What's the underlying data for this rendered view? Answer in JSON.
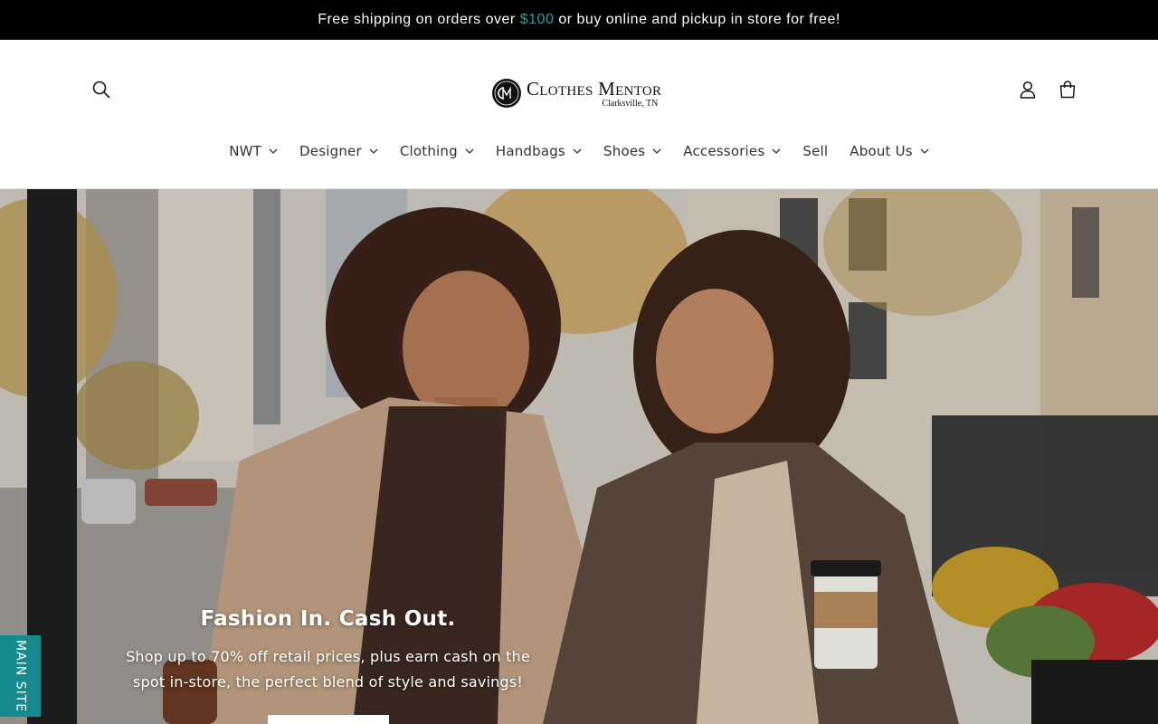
{
  "announcement": {
    "before": "Free shipping on orders over",
    "amount": "$100",
    "after": "or buy online and pickup in store for free!",
    "accent_color": "#1fa3a8"
  },
  "header": {
    "logo": {
      "name": "Clothes Mentor",
      "location": "Clarksville, TN",
      "monogram": "CM"
    },
    "icons": {
      "search": "search-icon",
      "account": "user-icon",
      "cart": "cart-icon"
    }
  },
  "nav": {
    "items": [
      {
        "label": "NWT",
        "has_dropdown": true
      },
      {
        "label": "Designer",
        "has_dropdown": true
      },
      {
        "label": "Clothing",
        "has_dropdown": true
      },
      {
        "label": "Handbags",
        "has_dropdown": true
      },
      {
        "label": "Shoes",
        "has_dropdown": true
      },
      {
        "label": "Accessories",
        "has_dropdown": true
      },
      {
        "label": "Sell",
        "has_dropdown": false
      },
      {
        "label": "About Us",
        "has_dropdown": true
      }
    ]
  },
  "hero": {
    "title": "Fashion In. Cash Out.",
    "text": "Shop up to 70% off retail prices, plus earn cash on the spot in-store, the perfect blend of style and savings!"
  },
  "side_tab": {
    "label": "MAIN SITE",
    "color": "#158b8f"
  }
}
